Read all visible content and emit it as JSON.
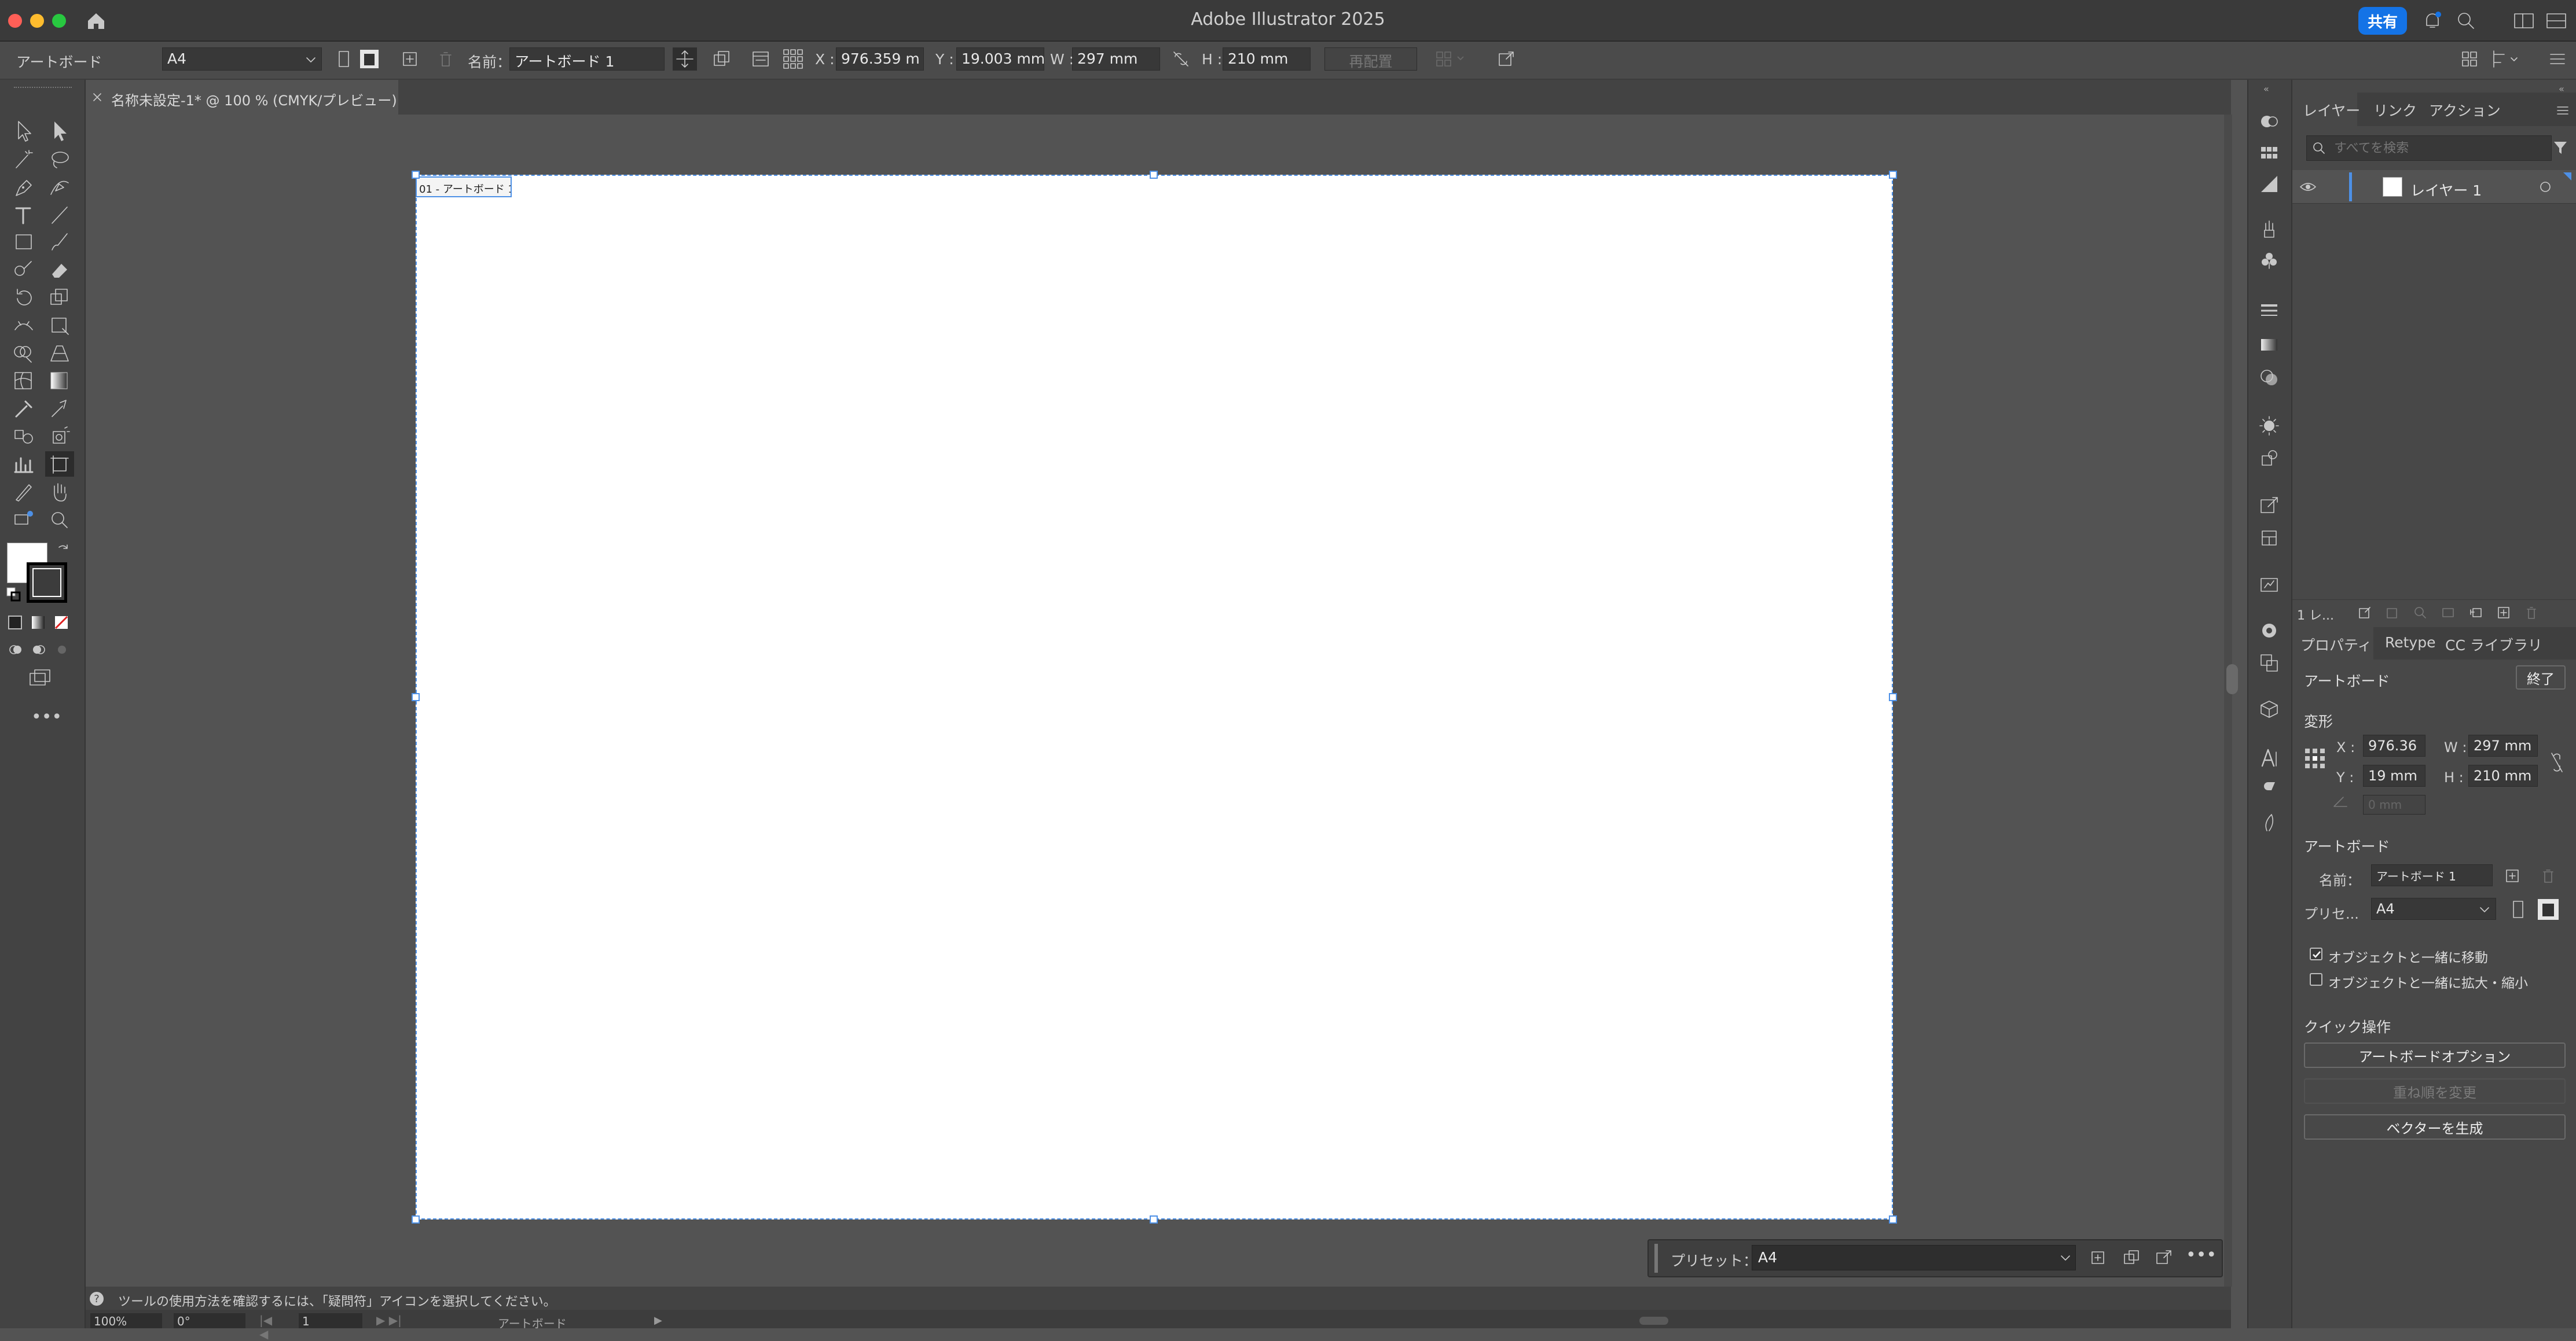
{
  "app": {
    "title": "Adobe Illustrator 2025",
    "share_label": "共有"
  },
  "control_bar": {
    "mode_label": "アートボード",
    "preset_value": "A4",
    "name_label": "名前：",
    "name_value": "アートボード 1",
    "x_label": "X :",
    "x_value": "976.359 m",
    "y_label": "Y :",
    "y_value": "19.003 mm",
    "w_label": "W :",
    "w_value": "297 mm",
    "h_label": "H :",
    "h_value": "210 mm",
    "rearrange_label": "再配置"
  },
  "document_tab": {
    "title": "名称未設定-1* @ 100 % (CMYK/プレビュー)"
  },
  "artboard": {
    "label": "01 - アートボード 1"
  },
  "layers_panel": {
    "tabs": [
      "レイヤー",
      "リンク",
      "アクション"
    ],
    "search_placeholder": "すべてを検索",
    "layer_name": "レイヤー 1",
    "footer_count": "1 レ..."
  },
  "properties_panel": {
    "tabs": [
      "プロパティ",
      "Retype",
      "CC ライブラリ"
    ],
    "section_artboard": "アートボード",
    "done_label": "終了",
    "section_transform": "変形",
    "x_label": "X :",
    "x_value": "976.36",
    "w_label": "W :",
    "w_value": "297 mm",
    "y_label": "Y :",
    "y_value": "19 mm",
    "h_label": "H :",
    "h_value": "210 mm",
    "angle_value": "0 mm",
    "section_artboard2": "アートボード",
    "name_label": "名前：",
    "name_value": "アートボード 1",
    "preset_label": "プリセ...",
    "preset_value": "A4",
    "move_with_object": "オブジェクトと一緒に移動",
    "scale_with_object": "オブジェクトと一緒に拡大・縮小",
    "move_checked": true,
    "scale_checked": false,
    "section_quick": "クイック操作",
    "artboard_options_btn": "アートボードオプション",
    "reorder_btn": "重ね順を変更",
    "vector_btn": "ベクターを生成"
  },
  "preset_bar": {
    "label": "プリセット：",
    "value": "A4"
  },
  "status": {
    "hint": "ツールの使用方法を確認するには、「疑問符」アイコンを選択してください。",
    "zoom": "100%",
    "rotation": "0°",
    "page": "1",
    "mode": "アートボード"
  },
  "colors": {
    "accent": "#1473e6",
    "selection": "#4d90e6",
    "artboard": "#ffffff",
    "canvas": "#535353"
  }
}
